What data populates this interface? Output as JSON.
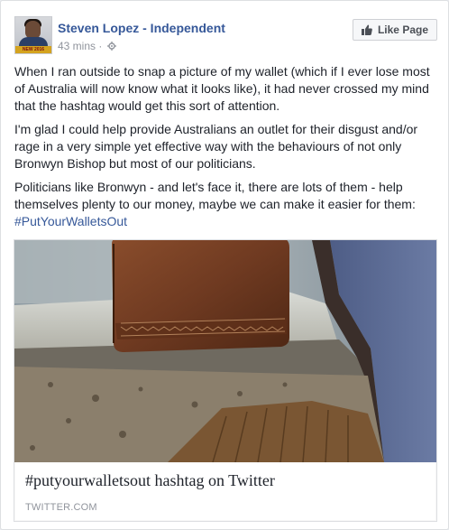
{
  "post": {
    "author": "Steven Lopez - Independent",
    "avatar_badge": "NEW 2016",
    "time": "43 mins",
    "privacy_icon": "gear-icon",
    "like_page_label": "Like Page",
    "paragraphs": [
      "When I ran outside to snap a picture of my wallet (which if I ever lose most of Australia will now know what it looks like), it had never crossed my mind that the hashtag would get this sort of attention.",
      "I'm glad I could help provide Australians an outlet for their disgust and/or rage in a very simple yet effective way with the behaviours of not only Bronwyn Bishop but most of our politicians.",
      "Politicians like Bronwyn - and let's face it, there are lots of them - help themselves plenty to our money, maybe we can make it easier for them:"
    ],
    "hashtag": "#PutYourWalletsOut"
  },
  "link_preview": {
    "image_icon": "wallet-photo",
    "title": "#putyourwalletsout hashtag on Twitter",
    "domain": "TWITTER.COM"
  },
  "colors": {
    "link_blue": "#365899",
    "meta_grey": "#90949c",
    "card_border": "#dddfe2"
  }
}
